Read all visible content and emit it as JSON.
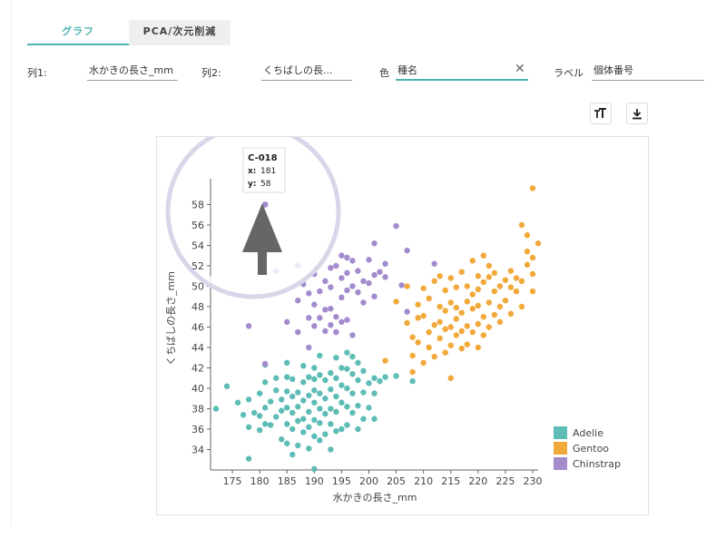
{
  "tabs": [
    {
      "label": "グラフ"
    },
    {
      "label": "PCA/次元削減"
    }
  ],
  "controls": {
    "col1_label": "列1:",
    "col1_value": "水かきの長さ_mm",
    "col2_label": "列2:",
    "col2_value": "くちばしの長...",
    "color_label": "色",
    "color_value": "種名",
    "label_label": "ラベル",
    "label_value": "個体番号"
  },
  "toolbar": {
    "font_size_icon": "font-size-icon",
    "download_icon": "download-icon"
  },
  "colors": {
    "accent": "#4bb3b0",
    "Adelie": "#5dbcb5",
    "Gentoo": "#f2a93b",
    "Chinstrap": "#a38bce",
    "highlight_ring": "#d9d6ea",
    "arrow": "#666666"
  },
  "tooltip": {
    "id": "C-018",
    "x_label": "x:",
    "x_value": "181",
    "y_label": "y:",
    "y_value": "58"
  },
  "chart_data": {
    "type": "scatter",
    "xlabel": "水かきの長さ_mm",
    "ylabel": "くちばしの長さ_mm",
    "xlim": [
      171,
      231
    ],
    "ylim": [
      32,
      60
    ],
    "xticks": [
      175,
      180,
      185,
      190,
      195,
      200,
      205,
      210,
      215,
      220,
      225,
      230
    ],
    "yticks": [
      34,
      36,
      38,
      40,
      42,
      44,
      46,
      48,
      50,
      52,
      54,
      56,
      58
    ],
    "grid": false,
    "legend_position": "bottom-right",
    "highlight": {
      "series": "Chinstrap",
      "x": 181,
      "y": 58
    },
    "series": [
      {
        "name": "Adelie",
        "points": [
          [
            172,
            38
          ],
          [
            174,
            40.2
          ],
          [
            176,
            38.6
          ],
          [
            177,
            37.4
          ],
          [
            178,
            33.1
          ],
          [
            178,
            36.2
          ],
          [
            178,
            38.9
          ],
          [
            179,
            37.6
          ],
          [
            180,
            35.9
          ],
          [
            180,
            37.3
          ],
          [
            180,
            39.5
          ],
          [
            181,
            36.5
          ],
          [
            181,
            38.1
          ],
          [
            181,
            40.6
          ],
          [
            181,
            42.3
          ],
          [
            182,
            36.4
          ],
          [
            182,
            38.7
          ],
          [
            183,
            37.2
          ],
          [
            183,
            39.8
          ],
          [
            183,
            41.0
          ],
          [
            184,
            35.0
          ],
          [
            184,
            37.8
          ],
          [
            184,
            38.9
          ],
          [
            185,
            34.6
          ],
          [
            185,
            36.5
          ],
          [
            185,
            38.1
          ],
          [
            185,
            39.7
          ],
          [
            185,
            41.1
          ],
          [
            185,
            42.5
          ],
          [
            186,
            33.5
          ],
          [
            186,
            36.0
          ],
          [
            186,
            37.6
          ],
          [
            186,
            39.2
          ],
          [
            186,
            40.9
          ],
          [
            187,
            34.4
          ],
          [
            187,
            36.8
          ],
          [
            187,
            38.2
          ],
          [
            187,
            39.6
          ],
          [
            188,
            35.7
          ],
          [
            188,
            37.0
          ],
          [
            188,
            38.8
          ],
          [
            188,
            40.6
          ],
          [
            188,
            42.2
          ],
          [
            189,
            34.1
          ],
          [
            189,
            36.2
          ],
          [
            189,
            37.7
          ],
          [
            189,
            39.3
          ],
          [
            189,
            41.1
          ],
          [
            190,
            32.1
          ],
          [
            190,
            35.3
          ],
          [
            190,
            36.9
          ],
          [
            190,
            38.6
          ],
          [
            190,
            39.8
          ],
          [
            190,
            40.9
          ],
          [
            190,
            42.0
          ],
          [
            191,
            34.9
          ],
          [
            191,
            36.6
          ],
          [
            191,
            38.0
          ],
          [
            191,
            39.5
          ],
          [
            191,
            41.3
          ],
          [
            191,
            43.2
          ],
          [
            192,
            35.5
          ],
          [
            192,
            37.5
          ],
          [
            192,
            39.0
          ],
          [
            192,
            40.8
          ],
          [
            193,
            34.0
          ],
          [
            193,
            36.5
          ],
          [
            193,
            38.0
          ],
          [
            193,
            39.9
          ],
          [
            193,
            41.5
          ],
          [
            194,
            35.8
          ],
          [
            194,
            37.7
          ],
          [
            194,
            39.2
          ],
          [
            194,
            41.0
          ],
          [
            194,
            43.0
          ],
          [
            195,
            36.0
          ],
          [
            195,
            38.6
          ],
          [
            195,
            40.3
          ],
          [
            195,
            42.0
          ],
          [
            196,
            36.4
          ],
          [
            196,
            38.2
          ],
          [
            196,
            40.0
          ],
          [
            196,
            41.9
          ],
          [
            196,
            43.5
          ],
          [
            197,
            37.6
          ],
          [
            197,
            39.5
          ],
          [
            197,
            41.4
          ],
          [
            197,
            43.1
          ],
          [
            198,
            36.0
          ],
          [
            198,
            38.3
          ],
          [
            198,
            40.8
          ],
          [
            198,
            42.5
          ],
          [
            199,
            37.0
          ],
          [
            199,
            39.6
          ],
          [
            199,
            41.7
          ],
          [
            200,
            38.1
          ],
          [
            200,
            40.5
          ],
          [
            201,
            37.0
          ],
          [
            201,
            39.5
          ],
          [
            201,
            41.0
          ],
          [
            202,
            40.7
          ],
          [
            203,
            41.1
          ],
          [
            205,
            41.2
          ],
          [
            208,
            40.7
          ]
        ]
      },
      {
        "name": "Gentoo",
        "points": [
          [
            203,
            42.7
          ],
          [
            205,
            48.5
          ],
          [
            207,
            50.0
          ],
          [
            207,
            46.4
          ],
          [
            208,
            45.0
          ],
          [
            208,
            43.2
          ],
          [
            208,
            41.6
          ],
          [
            209,
            44.5
          ],
          [
            209,
            46.9
          ],
          [
            209,
            48.2
          ],
          [
            210,
            42.5
          ],
          [
            210,
            47.1
          ],
          [
            210,
            49.8
          ],
          [
            211,
            44.0
          ],
          [
            211,
            45.5
          ],
          [
            211,
            48.8
          ],
          [
            212,
            43.1
          ],
          [
            212,
            46.2
          ],
          [
            212,
            50.5
          ],
          [
            213,
            44.9
          ],
          [
            213,
            46.5
          ],
          [
            213,
            48.0
          ],
          [
            213,
            51.0
          ],
          [
            214,
            43.5
          ],
          [
            214,
            45.8
          ],
          [
            214,
            47.6
          ],
          [
            214,
            49.6
          ],
          [
            215,
            41.0
          ],
          [
            215,
            44.2
          ],
          [
            215,
            46.0
          ],
          [
            215,
            48.4
          ],
          [
            215,
            50.8
          ],
          [
            216,
            45.2
          ],
          [
            216,
            46.8
          ],
          [
            216,
            47.9
          ],
          [
            216,
            49.9
          ],
          [
            217,
            43.9
          ],
          [
            217,
            45.6
          ],
          [
            217,
            47.4
          ],
          [
            217,
            51.4
          ],
          [
            218,
            44.3
          ],
          [
            218,
            46.1
          ],
          [
            218,
            48.5
          ],
          [
            218,
            50.0
          ],
          [
            219,
            45.5
          ],
          [
            219,
            47.8
          ],
          [
            219,
            49.2
          ],
          [
            219,
            52.5
          ],
          [
            220,
            44.0
          ],
          [
            220,
            46.3
          ],
          [
            220,
            48.1
          ],
          [
            220,
            49.7
          ],
          [
            220,
            51.0
          ],
          [
            221,
            45.2
          ],
          [
            221,
            47.0
          ],
          [
            221,
            50.4
          ],
          [
            221,
            53.0
          ],
          [
            222,
            46.0
          ],
          [
            222,
            48.4
          ],
          [
            222,
            50.9
          ],
          [
            222,
            52.0
          ],
          [
            223,
            47.2
          ],
          [
            223,
            49.5
          ],
          [
            223,
            51.3
          ],
          [
            224,
            46.5
          ],
          [
            224,
            48.0
          ],
          [
            224,
            50.0
          ],
          [
            225,
            48.6
          ],
          [
            225,
            50.6
          ],
          [
            226,
            47.3
          ],
          [
            226,
            49.9
          ],
          [
            226,
            51.5
          ],
          [
            227,
            49.5
          ],
          [
            227,
            50.8
          ],
          [
            228,
            48.0
          ],
          [
            228,
            50.5
          ],
          [
            228,
            56.0
          ],
          [
            229,
            52.1
          ],
          [
            229,
            53.4
          ],
          [
            229,
            55.0
          ],
          [
            230,
            49.5
          ],
          [
            230,
            51.2
          ],
          [
            230,
            52.8
          ],
          [
            230,
            59.6
          ],
          [
            231,
            54.2
          ]
        ]
      },
      {
        "name": "Chinstrap",
        "points": [
          [
            178,
            46.1
          ],
          [
            181,
            58.0
          ],
          [
            181,
            42.4
          ],
          [
            183,
            51.5
          ],
          [
            185,
            46.5
          ],
          [
            187,
            45.5
          ],
          [
            187,
            48.6
          ],
          [
            187,
            52.0
          ],
          [
            188,
            50.2
          ],
          [
            189,
            44.0
          ],
          [
            189,
            46.9
          ],
          [
            189,
            49.3
          ],
          [
            190,
            46.1
          ],
          [
            190,
            48.2
          ],
          [
            190,
            51.2
          ],
          [
            191,
            46.9
          ],
          [
            191,
            49.5
          ],
          [
            192,
            45.6
          ],
          [
            192,
            47.7
          ],
          [
            192,
            50.5
          ],
          [
            193,
            46.2
          ],
          [
            193,
            47.8
          ],
          [
            193,
            49.9
          ],
          [
            193,
            51.8
          ],
          [
            194,
            45.5
          ],
          [
            194,
            47.0
          ],
          [
            194,
            52.0
          ],
          [
            195,
            46.5
          ],
          [
            195,
            48.9
          ],
          [
            195,
            50.8
          ],
          [
            195,
            53.0
          ],
          [
            196,
            46.7
          ],
          [
            196,
            49.6
          ],
          [
            196,
            51.3
          ],
          [
            196,
            52.8
          ],
          [
            197,
            45.2
          ],
          [
            197,
            50.0
          ],
          [
            197,
            52.5
          ],
          [
            198,
            49.4
          ],
          [
            198,
            51.5
          ],
          [
            199,
            48.4
          ],
          [
            199,
            50.5
          ],
          [
            200,
            50.3
          ],
          [
            200,
            52.6
          ],
          [
            201,
            49.0
          ],
          [
            201,
            51.1
          ],
          [
            201,
            54.2
          ],
          [
            202,
            51.4
          ],
          [
            203,
            50.9
          ],
          [
            203,
            52.2
          ],
          [
            205,
            55.9
          ],
          [
            206,
            50.1
          ],
          [
            207,
            47.5
          ],
          [
            207,
            53.5
          ],
          [
            212,
            52.2
          ]
        ]
      }
    ]
  }
}
